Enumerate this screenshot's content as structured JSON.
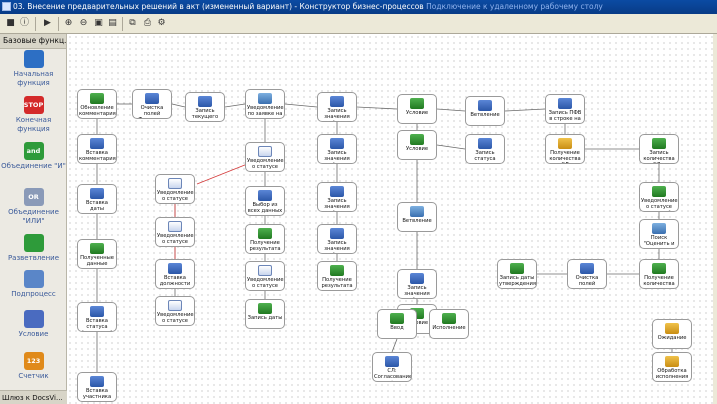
{
  "window": {
    "title": "03. Внесение предварительных решений в акт (измененный вариант) - Конструктор бизнес-процессов",
    "connection_title": "Подключение к удаленному рабочему столу"
  },
  "toolbar": {
    "buttons": [
      "menu-icon",
      "info-icon",
      "run-icon",
      "zoom-in-icon",
      "zoom-out-icon",
      "fit-icon",
      "page-icon",
      "copy-icon",
      "print-icon",
      "settings-icon"
    ]
  },
  "palette": {
    "title": "Базовые функц...",
    "items": [
      {
        "label": "Начальная функция",
        "icon": "arrow-up-icon",
        "icon_text": "",
        "color": "#2d6fc4"
      },
      {
        "label": "Конечная функция",
        "icon": "stop-icon",
        "icon_text": "STOP",
        "color": "#d42a2a"
      },
      {
        "label": "Объединение \"И\"",
        "icon": "and-icon",
        "icon_text": "and",
        "color": "#2e9b3a"
      },
      {
        "label": "Объединение \"ИЛИ\"",
        "icon": "or-icon",
        "icon_text": "OR",
        "color": "#8a9ab8"
      },
      {
        "label": "Разветвление",
        "icon": "split-icon",
        "icon_text": "",
        "color": "#2e9b3a"
      },
      {
        "label": "Подпроцесс",
        "icon": "subprocess-icon",
        "icon_text": "",
        "color": "#5a86c8"
      },
      {
        "label": "Условие",
        "icon": "condition-icon",
        "icon_text": "",
        "color": "#4a6bc0"
      },
      {
        "label": "Счетчик",
        "icon": "counter-icon",
        "icon_text": "123",
        "color": "#e08a1a"
      }
    ],
    "footer": "Шлюз к DocsVi..."
  },
  "nodes": [
    {
      "label": "Обновление комментария",
      "icon": "ic-green"
    },
    {
      "label": "Очистка полей Текущего исполнителя",
      "icon": "ic-blue"
    },
    {
      "label": "Запись текущего",
      "icon": "ic-blue"
    },
    {
      "label": "Уведомление по заявке на изменение",
      "icon": "ic-sep"
    },
    {
      "label": "Запись значения свойства - результат",
      "icon": "ic-blue"
    },
    {
      "label": "Условие",
      "icon": "ic-green"
    },
    {
      "label": "Ветвление",
      "icon": "ic-blue"
    },
    {
      "label": "Запись ПФВ в строке на согласие",
      "icon": "ic-blue"
    },
    {
      "label": "Вставка комментария",
      "icon": "ic-blue"
    },
    {
      "label": "Уведомление о статусе после проверки",
      "icon": "ic-doc"
    },
    {
      "label": "Запись значения свойства - статус",
      "icon": "ic-blue"
    },
    {
      "label": "Условие",
      "icon": "ic-green"
    },
    {
      "label": "Запись статуса решения",
      "icon": "ic-blue"
    },
    {
      "label": "Получение количества СЛ",
      "icon": "ic-folder"
    },
    {
      "label": "Запись количества СЛ в карточку",
      "icon": "ic-green"
    },
    {
      "label": "Уведомление о статусе после ввода",
      "icon": "ic-doc"
    },
    {
      "label": "Выбор из всех данных в карточку",
      "icon": "ic-blue"
    },
    {
      "label": "Запись значения свойства - ФИО",
      "icon": "ic-blue"
    },
    {
      "label": "Вставка даты",
      "icon": "ic-blue"
    },
    {
      "label": "Ветвление",
      "icon": "ic-sep"
    },
    {
      "label": "Уведомление о статусе решений",
      "icon": "ic-green"
    },
    {
      "label": "Уведомление о статусе после ввода",
      "icon": "ic-doc"
    },
    {
      "label": "Получение результата согласования",
      "icon": "ic-green"
    },
    {
      "label": "Запись значения свойства - результат",
      "icon": "ic-blue"
    },
    {
      "label": "Поиск \"Оценить и утверждение\"",
      "icon": "ic-sep"
    },
    {
      "label": "Полученные данные",
      "icon": "ic-green"
    },
    {
      "label": "Вставка должности",
      "icon": "ic-blue"
    },
    {
      "label": "Уведомление о статусе после ввода",
      "icon": "ic-doc"
    },
    {
      "label": "Получение результата",
      "icon": "ic-green"
    },
    {
      "label": "Запись значения свойства - дата",
      "icon": "ic-blue"
    },
    {
      "label": "Запись даты",
      "icon": "ic-green"
    },
    {
      "label": "Очистка полей текущего исполнителя",
      "icon": "ic-blue"
    },
    {
      "label": "Получение количества в завершенных",
      "icon": "ic-green"
    },
    {
      "label": "Уведомление о статусе после ввода",
      "icon": "ic-doc"
    },
    {
      "label": "Запись даты утверждения",
      "icon": "ic-green"
    },
    {
      "label": "Условие",
      "icon": "ic-green"
    },
    {
      "label": "Вставка статуса (нужен рм)",
      "icon": "ic-blue"
    },
    {
      "label": "Ввод",
      "icon": "ic-green"
    },
    {
      "label": "Исполнение",
      "icon": "ic-green"
    },
    {
      "label": "Ожидание",
      "icon": "ic-folder"
    },
    {
      "label": "СЛ: Согласование + Подписание документов",
      "icon": "ic-blue"
    },
    {
      "label": "Обработка исполнения",
      "icon": "ic-folder"
    },
    {
      "label": "Вставка участника согласования в запись заявки",
      "icon": "ic-blue"
    }
  ]
}
